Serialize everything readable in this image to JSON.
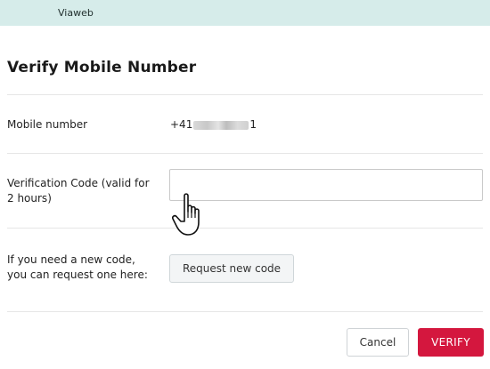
{
  "header": {
    "brand": "Viaweb"
  },
  "page": {
    "title": "Verify Mobile Number"
  },
  "mobile": {
    "label": "Mobile number",
    "value_prefix": "+41",
    "value_suffix": "1"
  },
  "verification": {
    "label_line1": "Verification Code (valid for",
    "label_line2": "2 hours)",
    "value": ""
  },
  "new_code": {
    "label_line1": "If you need a new code,",
    "label_line2": "you can request one here:",
    "button_label": "Request new code"
  },
  "actions": {
    "cancel_label": "Cancel",
    "verify_label": "VERIFY"
  },
  "colors": {
    "header_bg": "#d6ecea",
    "verify_bg": "#d4173e"
  },
  "icons": {
    "cursor": "hand-pointer-icon"
  }
}
